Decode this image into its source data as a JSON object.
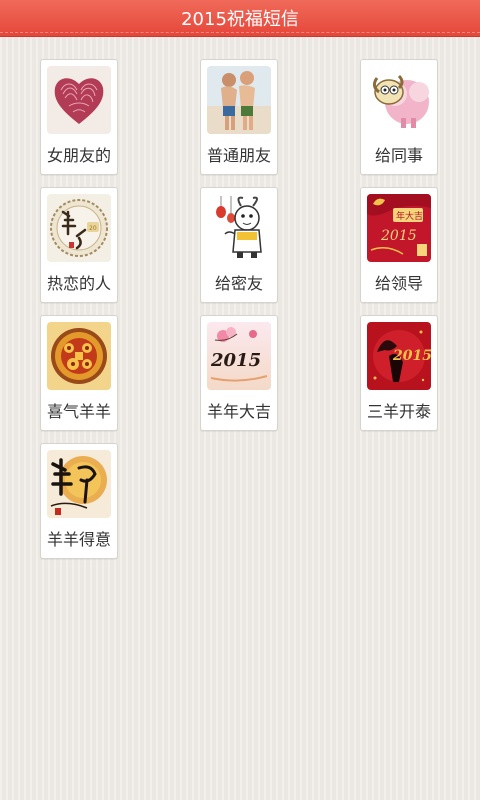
{
  "app": {
    "title": "2015祝福短信"
  },
  "categories": [
    {
      "label": "女朋友的",
      "icon": "fingerprint-heart-icon"
    },
    {
      "label": "普通朋友",
      "icon": "friends-beach-photo-icon"
    },
    {
      "label": "给同事",
      "icon": "cartoon-sheep-icon"
    },
    {
      "label": "热恋的人",
      "icon": "sheep-calligraphy-icon"
    },
    {
      "label": "给密友",
      "icon": "cartoon-goat-lantern-icon"
    },
    {
      "label": "给领导",
      "icon": "red-year-card-icon"
    },
    {
      "label": "喜气羊羊",
      "icon": "golden-papercut-icon"
    },
    {
      "label": "羊年大吉",
      "icon": "2015-flowers-icon"
    },
    {
      "label": "三羊开泰",
      "icon": "red-2015-goat-icon"
    },
    {
      "label": "羊羊得意",
      "icon": "sheep-brush-character-icon"
    }
  ],
  "colors": {
    "titlebar": "#e5473a",
    "background": "#efebe6"
  }
}
